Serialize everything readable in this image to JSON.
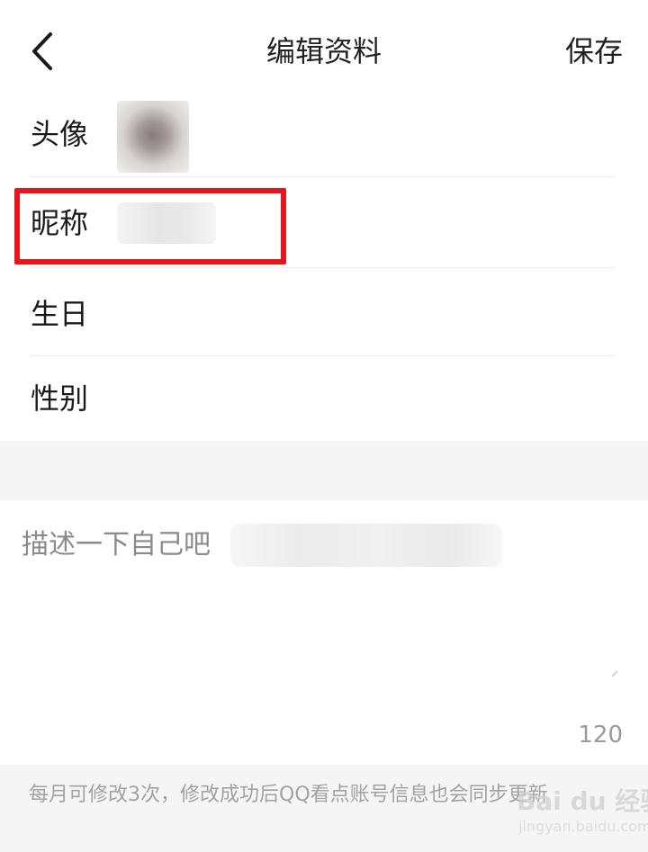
{
  "header": {
    "title": "编辑资料",
    "save_label": "保存"
  },
  "form": {
    "rows": [
      {
        "label": "头像"
      },
      {
        "label": "昵称"
      },
      {
        "label": "生日"
      },
      {
        "label": "性别"
      }
    ]
  },
  "description": {
    "placeholder": "描述一下自己吧",
    "char_count": "120"
  },
  "footer": {
    "note": "每月可修改3次，修改成功后QQ看点账号信息也会同步更新"
  },
  "watermark": {
    "brand": "Bai du 经验",
    "url": "jingyan.baidu.com"
  },
  "colors": {
    "highlight": "#e8141b",
    "background_gray": "#f5f5f5"
  }
}
